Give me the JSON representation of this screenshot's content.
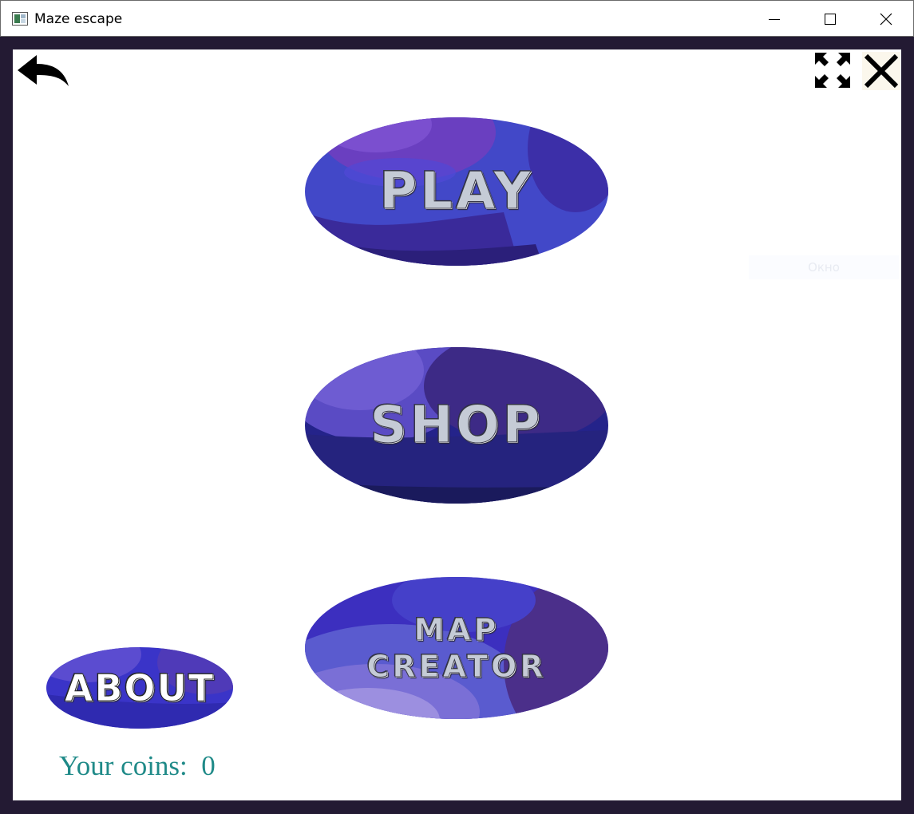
{
  "window": {
    "title": "Maze escape",
    "controls": {
      "minimize": "minimize",
      "maximize": "maximize",
      "close": "close"
    }
  },
  "toolbar": {
    "back_icon": "back-arrow-icon",
    "fullscreen_icon": "fullscreen-icon",
    "close_icon": "close-icon"
  },
  "menu": {
    "play": "PLAY",
    "shop": "SHOP",
    "map_creator_line1": "MAP",
    "map_creator_line2": "CREATOR",
    "about": "ABOUT"
  },
  "ghost_label": "Окно",
  "status": {
    "coins_label": "Your coins:",
    "coins_value": "0"
  },
  "colors": {
    "frame": "#231a33",
    "button_blue": "#3f44c4",
    "button_purple": "#5a3ab2",
    "coins_text": "#1f8a88"
  }
}
